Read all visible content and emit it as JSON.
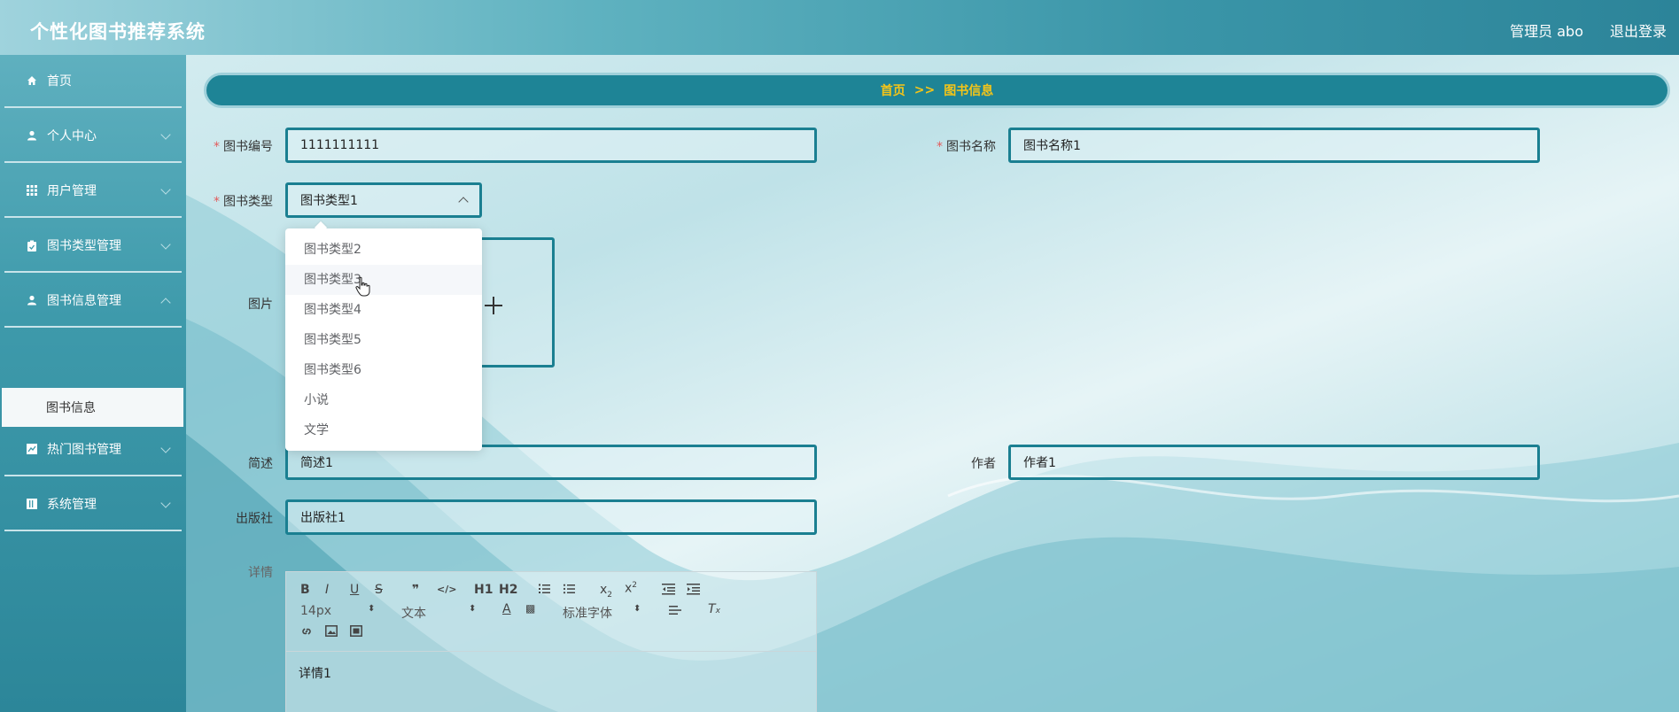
{
  "header": {
    "title": "个性化图书推荐系统",
    "user": "管理员 abo",
    "logout": "退出登录"
  },
  "sidebar": {
    "items": [
      {
        "label": "首页"
      },
      {
        "label": "个人中心"
      },
      {
        "label": "用户管理"
      },
      {
        "label": "图书类型管理"
      },
      {
        "label": "图书信息管理"
      },
      {
        "label": "热门图书管理"
      },
      {
        "label": "系统管理"
      }
    ],
    "sub_active": "图书信息"
  },
  "breadcrumb": {
    "home": "首页",
    "sep": ">>",
    "current": "图书信息"
  },
  "form": {
    "book_no": {
      "label": "图书编号",
      "value": "1111111111"
    },
    "book_name": {
      "label": "图书名称",
      "value": "图书名称1"
    },
    "book_type": {
      "label": "图书类型",
      "value": "图书类型1"
    },
    "image": {
      "label": "图片"
    },
    "summary": {
      "label": "简述",
      "value": "简述1"
    },
    "author": {
      "label": "作者",
      "value": "作者1"
    },
    "publisher": {
      "label": "出版社",
      "value": "出版社1"
    },
    "detail": {
      "label": "详情",
      "value": "详情1"
    }
  },
  "dropdown": {
    "options": [
      "图书类型2",
      "图书类型3",
      "图书类型4",
      "图书类型5",
      "图书类型6",
      "小说",
      "文学"
    ],
    "hovered_index": 1
  },
  "editor": {
    "font_size": "14px",
    "block_type": "文本",
    "font_family": "标准字体",
    "buttons": [
      "B",
      "I",
      "U",
      "S",
      "❞",
      "</>",
      "H1",
      "H2"
    ]
  }
}
